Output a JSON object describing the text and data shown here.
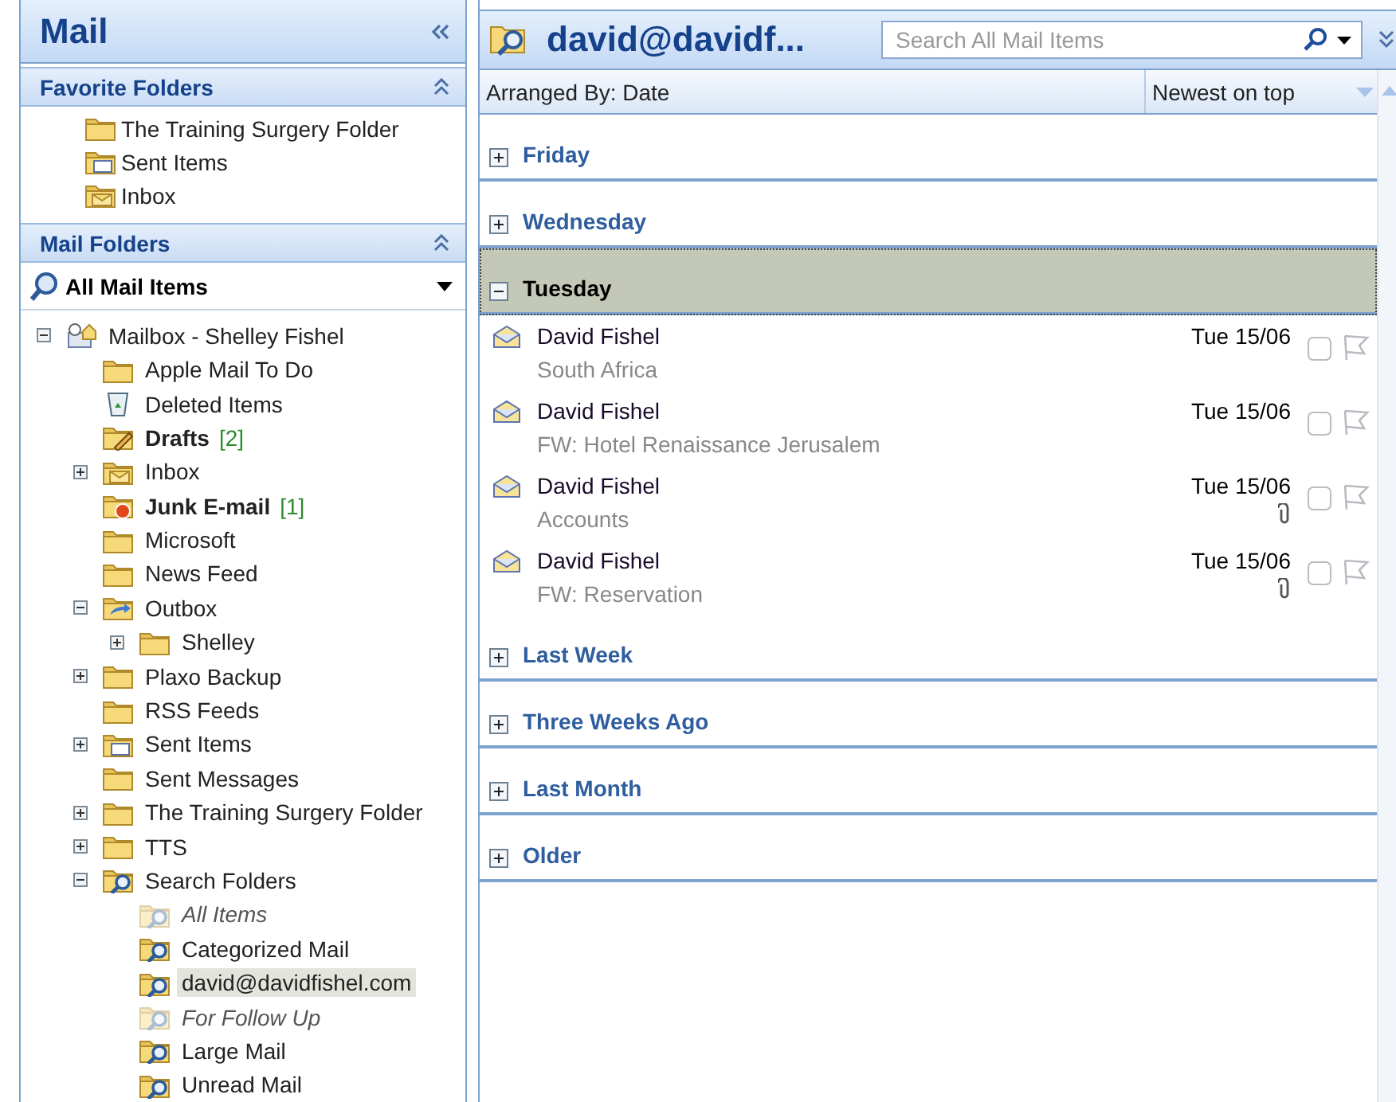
{
  "navigation": {
    "title": "Mail",
    "favorite_folders": {
      "title": "Favorite Folders",
      "items": [
        {
          "label": "The Training Surgery Folder",
          "kind": "folder"
        },
        {
          "label": "Sent Items",
          "kind": "sent"
        },
        {
          "label": "Inbox",
          "kind": "inbox"
        }
      ]
    },
    "mail_folders": {
      "title": "Mail Folders",
      "view": "All Mail Items",
      "tree": [
        {
          "label": "Mailbox - Shelley Fishel",
          "kind": "mailbox",
          "expanded": true,
          "selected": false,
          "children": [
            {
              "label": "Apple Mail To Do",
              "kind": "folder",
              "selected": false
            },
            {
              "label": "Deleted Items",
              "kind": "trash",
              "selected": false
            },
            {
              "label": "Drafts",
              "kind": "drafts",
              "count": "[2]",
              "selected": false
            },
            {
              "label": "Inbox",
              "kind": "inbox",
              "expanded": false,
              "selected": false
            },
            {
              "label": "Junk E-mail",
              "kind": "junk",
              "count": "[1]",
              "selected": false
            },
            {
              "label": "Microsoft",
              "kind": "folder",
              "selected": false
            },
            {
              "label": "News Feed",
              "kind": "folder",
              "selected": false
            },
            {
              "label": "Outbox",
              "kind": "outbox",
              "expanded": true,
              "selected": false,
              "children": [
                {
                  "label": "Shelley",
                  "kind": "folder",
                  "expanded": false,
                  "selected": false
                }
              ]
            },
            {
              "label": "Plaxo Backup",
              "kind": "folder",
              "expanded": false,
              "selected": false
            },
            {
              "label": "RSS Feeds",
              "kind": "folder",
              "selected": false
            },
            {
              "label": "Sent Items",
              "kind": "sent",
              "expanded": false,
              "selected": false
            },
            {
              "label": "Sent Messages",
              "kind": "folder",
              "selected": false
            },
            {
              "label": "The Training Surgery Folder",
              "kind": "folder",
              "expanded": false,
              "selected": false
            },
            {
              "label": "TTS",
              "kind": "folder",
              "expanded": false,
              "selected": false
            },
            {
              "label": "Search Folders",
              "kind": "search",
              "expanded": true,
              "selected": false,
              "children": [
                {
                  "label": "All Items",
                  "kind": "search",
                  "dimmed": true,
                  "selected": false
                },
                {
                  "label": "Categorized Mail",
                  "kind": "search",
                  "dimmed": false,
                  "selected": false
                },
                {
                  "label": "david@davidfishel.com",
                  "kind": "search",
                  "dimmed": false,
                  "selected": true
                },
                {
                  "label": "For Follow Up",
                  "kind": "search",
                  "dimmed": true,
                  "selected": false
                },
                {
                  "label": "Large Mail",
                  "kind": "search",
                  "dimmed": false,
                  "selected": false
                },
                {
                  "label": "Unread Mail",
                  "kind": "search",
                  "dimmed": false,
                  "selected": false
                }
              ]
            }
          ]
        }
      ]
    }
  },
  "mail_list": {
    "title": "david@davidf...",
    "search": {
      "placeholder": "Search All Mail Items"
    },
    "arranged_by": "Arranged By: Date",
    "sort_order": "Newest on top",
    "groups": [
      {
        "label": "Friday",
        "expanded": false,
        "selected": false
      },
      {
        "label": "Wednesday",
        "expanded": false,
        "selected": false
      },
      {
        "label": "Tuesday",
        "expanded": true,
        "selected": true,
        "messages": [
          {
            "sender": "David Fishel",
            "subject": "South Africa",
            "date": "Tue 15/06",
            "attachment": false
          },
          {
            "sender": "David Fishel",
            "subject": "FW: Hotel Renaissance Jerusalem",
            "date": "Tue 15/06",
            "attachment": false
          },
          {
            "sender": "David Fishel",
            "subject": "Accounts",
            "date": "Tue 15/06",
            "attachment": true
          },
          {
            "sender": "David Fishel",
            "subject": "FW: Reservation",
            "date": "Tue 15/06",
            "attachment": true
          }
        ]
      },
      {
        "label": "Last Week",
        "expanded": false,
        "selected": false
      },
      {
        "label": "Three Weeks Ago",
        "expanded": false,
        "selected": false
      },
      {
        "label": "Last Month",
        "expanded": false,
        "selected": false
      },
      {
        "label": "Older",
        "expanded": false,
        "selected": false
      }
    ]
  }
}
